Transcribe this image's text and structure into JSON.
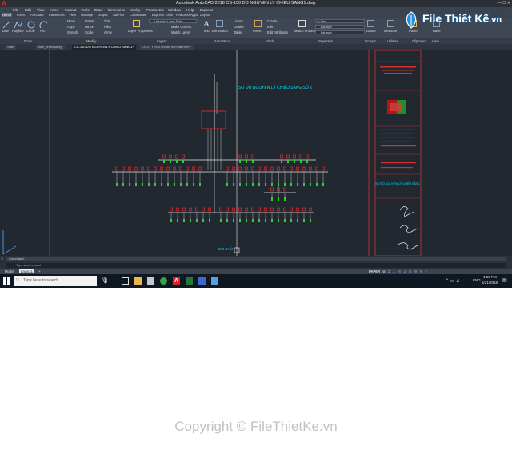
{
  "window": {
    "title": "Autodesk AutoCAD 2018    CS-150 DO NGUYEN LY CHIEU SANG1.dwg",
    "app_letter": "A"
  },
  "menubar": {
    "items": [
      "File",
      "Edit",
      "View",
      "Insert",
      "Format",
      "Tools",
      "Draw",
      "Dimension",
      "Modify",
      "Parametric",
      "Window",
      "Help",
      "Express"
    ]
  },
  "ribbon_tabs": {
    "items": [
      "Home",
      "Insert",
      "Annotate",
      "Parametric",
      "View",
      "Manage",
      "Output",
      "Add-ins",
      "Collaborate",
      "Express Tools",
      "Featured Apps",
      "Layout"
    ],
    "active": "Home"
  },
  "ribbon": {
    "draw_tools": [
      "Line",
      "Polyline",
      "Circle",
      "Arc"
    ],
    "modify_tools": [
      "Move",
      "Rotate",
      "Trim",
      "Copy",
      "Mirror",
      "Fillet",
      "Stretch",
      "Scale",
      "Array"
    ],
    "layer_tools": [
      "Layer Properties",
      "Make Current",
      "Match Layer"
    ],
    "annotation_tools": [
      "Text",
      "Dimension",
      "Linear",
      "Leader",
      "Table"
    ],
    "block_tools": [
      "Insert",
      "Create",
      "Edit",
      "Edit Attributes"
    ],
    "properties_tools": [
      "Match Properties"
    ],
    "unsaved_layer_state": "Unsaved Layer State",
    "color_combo": "Red",
    "linetype_combo": "ByLayer",
    "lineweight_combo": "ByLayer",
    "group_tool": "Group",
    "measure_tool": "Measure",
    "paste_tool": "Paste",
    "base_tool": "Base",
    "panels": [
      "Draw",
      "Modify",
      "Layers",
      "Annotation",
      "Block",
      "Properties",
      "Groups",
      "Utilities",
      "Clipboard",
      "View"
    ]
  },
  "doc_tabs": {
    "items": [
      "Start",
      "Ban_chieu sang*",
      "CS-150 DO NGUYEN LY CHIEU SANG1*",
      "CS-17 TRCS chi tiet noi mat RMP*"
    ],
    "active_index": 2
  },
  "drawing": {
    "diagram_title": "SƠ ĐỒ NGUYÊN LÝ CHIẾU SÁNG SỐ 2",
    "note_label": "GHI CHÚ",
    "titleblock_stamp": "SƠ ĐỒ NGUYÊN LÝ CHIẾU SÁNG",
    "colors": {
      "background": "#212830",
      "cyan": "#00e5ff",
      "red": "#ff2a2a",
      "yellow": "#ffe600",
      "green": "#2bd62b",
      "white": "#e6e6e6",
      "frame": "#b03030"
    }
  },
  "command_line": {
    "history": "Command:",
    "prompt": "Type a command"
  },
  "layout_tabs": {
    "items": [
      "Model",
      "Layout1",
      "+"
    ],
    "active": "Layout1"
  },
  "status_bar": {
    "paper_label": "PAPER"
  },
  "taskbar": {
    "search_placeholder": "Type here to search",
    "time": "1:50 PM",
    "date": "5/21/2018",
    "lang": "ENG"
  },
  "watermark": {
    "brand_main": "File Thiết Kế",
    "brand_suffix": ".vn",
    "copyright": "Copyright © FileThietKe.vn"
  }
}
